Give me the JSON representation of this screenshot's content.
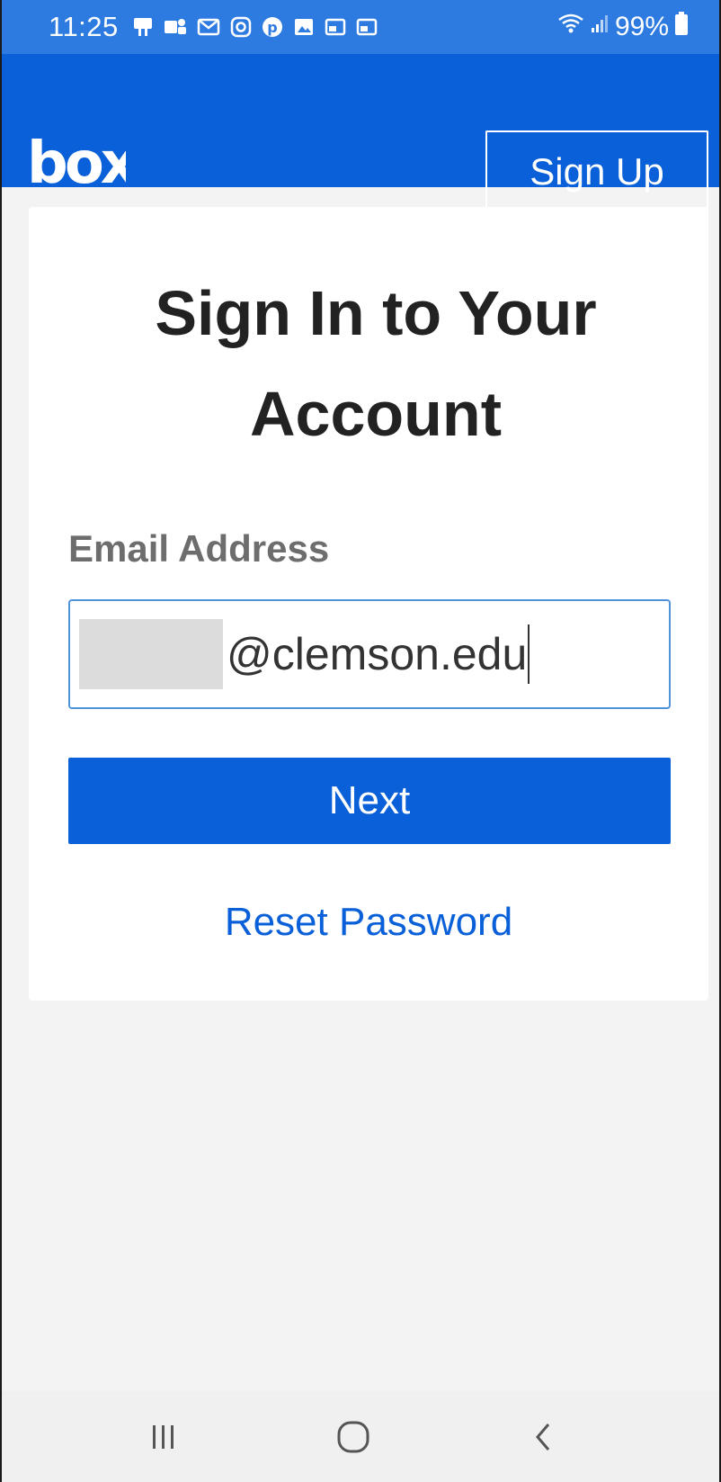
{
  "status_bar": {
    "time": "11:25",
    "battery": "99%",
    "notification_icons": [
      "voicemail-icon",
      "teams-icon",
      "gmail-icon",
      "instagram-icon",
      "pinterest-icon",
      "gallery-icon",
      "cast-icon",
      "cast-icon"
    ],
    "system_icons": [
      "wifi-icon",
      "signal-icon",
      "battery-icon"
    ]
  },
  "app_bar": {
    "logo": "box",
    "signup_label": "Sign Up"
  },
  "card": {
    "title": "Sign In to Your Account",
    "email_label": "Email Address",
    "email_value": "@clemson.edu",
    "next_label": "Next",
    "reset_label": "Reset Password"
  },
  "nav_bar": {
    "buttons": [
      "recent-apps-icon",
      "home-icon",
      "back-icon"
    ]
  },
  "colors": {
    "status_bar": "#2d7be0",
    "brand_blue": "#0a60d8",
    "background": "#f3f3f3",
    "input_border": "#4f94da"
  }
}
